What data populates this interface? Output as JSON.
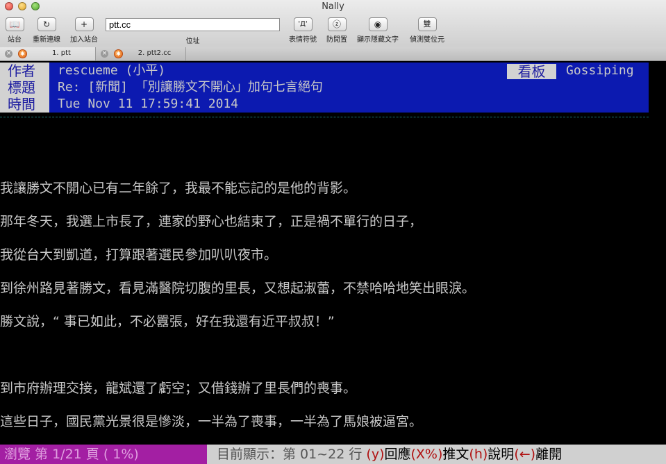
{
  "window": {
    "title": "Nally"
  },
  "toolbar": {
    "items": [
      {
        "label": "站台",
        "icon": "book-icon",
        "glyph": "📖"
      },
      {
        "label": "重新連線",
        "icon": "reload-icon",
        "glyph": "↻"
      },
      {
        "label": "加入站台",
        "icon": "plus-icon",
        "glyph": "+"
      },
      {
        "label": "表情符號",
        "icon": "emoticon-icon",
        "glyph": "'Д'"
      },
      {
        "label": "防閒置",
        "icon": "anti-idle-icon",
        "glyph": "ⓩ"
      },
      {
        "label": "顯示隱藏文字",
        "icon": "eye-icon",
        "glyph": "◉"
      },
      {
        "label": "偵測雙位元",
        "icon": "double-byte-icon",
        "glyph": "雙"
      }
    ],
    "address_value": "ptt.cc",
    "address_label": "位址"
  },
  "tabs": [
    {
      "label": "1. ptt",
      "active": true
    },
    {
      "label": "2. ptt2.cc",
      "active": false
    }
  ],
  "article": {
    "author_key": "作者",
    "author": "rescueme (小平)",
    "board_key": "看板",
    "board": "Gossiping",
    "title_key": "標題",
    "title": "Re: [新聞] 「別讓勝文不開心」加句七言絕句",
    "time_key": "時間",
    "time": "Tue Nov 11 17:59:41 2014",
    "lines": [
      "我讓勝文不開心已有二年餘了，我最不能忘記的是他的背影。",
      "那年冬天，我選上市長了，連家的野心也結束了，正是禍不單行的日子，",
      "我從台大到凱道，打算跟著選民參加叭叭夜市。",
      "到徐州路見著勝文，看見滿醫院切腹的里長，又想起淑蕾，不禁哈哈地笑出眼淚。",
      "勝文說，“ 事已如此，不必囂張，好在我還有近平叔叔！”",
      "到市府辦理交接，龍斌還了虧空；又借錢辦了里長們的喪事。",
      "這些日子，國民黨光景很是慘淡，一半為了喪事，一半為了馬娘被逼宮。"
    ]
  },
  "status": {
    "browse": "瀏覽 第 1/21 頁 (  1%)",
    "display_prefix": "目前顯示：第 01~22 行",
    "keys": [
      {
        "key": "(y)",
        "text": "回應"
      },
      {
        "key": "(X%)",
        "text": "推文"
      },
      {
        "key": "(h)",
        "text": "說明"
      },
      {
        "key": "(←)",
        "text": "離開"
      }
    ]
  }
}
